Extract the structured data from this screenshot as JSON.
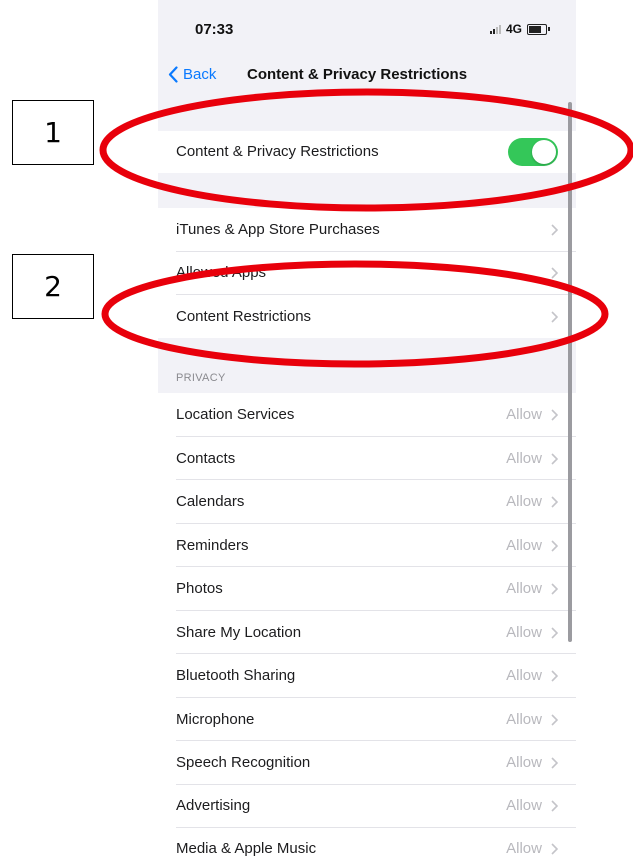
{
  "status_bar": {
    "time": "07:33",
    "network": "4G"
  },
  "nav": {
    "back_label": "Back",
    "title": "Content & Privacy Restrictions"
  },
  "toggle_row": {
    "label": "Content & Privacy Restrictions",
    "toggle_on": true
  },
  "menu_rows": [
    {
      "label": "iTunes & App Store Purchases"
    },
    {
      "label": "Allowed Apps"
    },
    {
      "label": "Content Restrictions"
    }
  ],
  "privacy": {
    "header": "PRIVACY",
    "rows": [
      {
        "label": "Location Services",
        "value": "Allow"
      },
      {
        "label": "Contacts",
        "value": "Allow"
      },
      {
        "label": "Calendars",
        "value": "Allow"
      },
      {
        "label": "Reminders",
        "value": "Allow"
      },
      {
        "label": "Photos",
        "value": "Allow"
      },
      {
        "label": "Share My Location",
        "value": "Allow"
      },
      {
        "label": "Bluetooth Sharing",
        "value": "Allow"
      },
      {
        "label": "Microphone",
        "value": "Allow"
      },
      {
        "label": "Speech Recognition",
        "value": "Allow"
      },
      {
        "label": "Advertising",
        "value": "Allow"
      },
      {
        "label": "Media & Apple Music",
        "value": "Allow"
      }
    ]
  },
  "annotations": {
    "callout_1": "1",
    "callout_2": "2",
    "highlight_color": "#e8000b"
  },
  "colors": {
    "accent": "#0a7aff",
    "toggle_on": "#34c759"
  }
}
